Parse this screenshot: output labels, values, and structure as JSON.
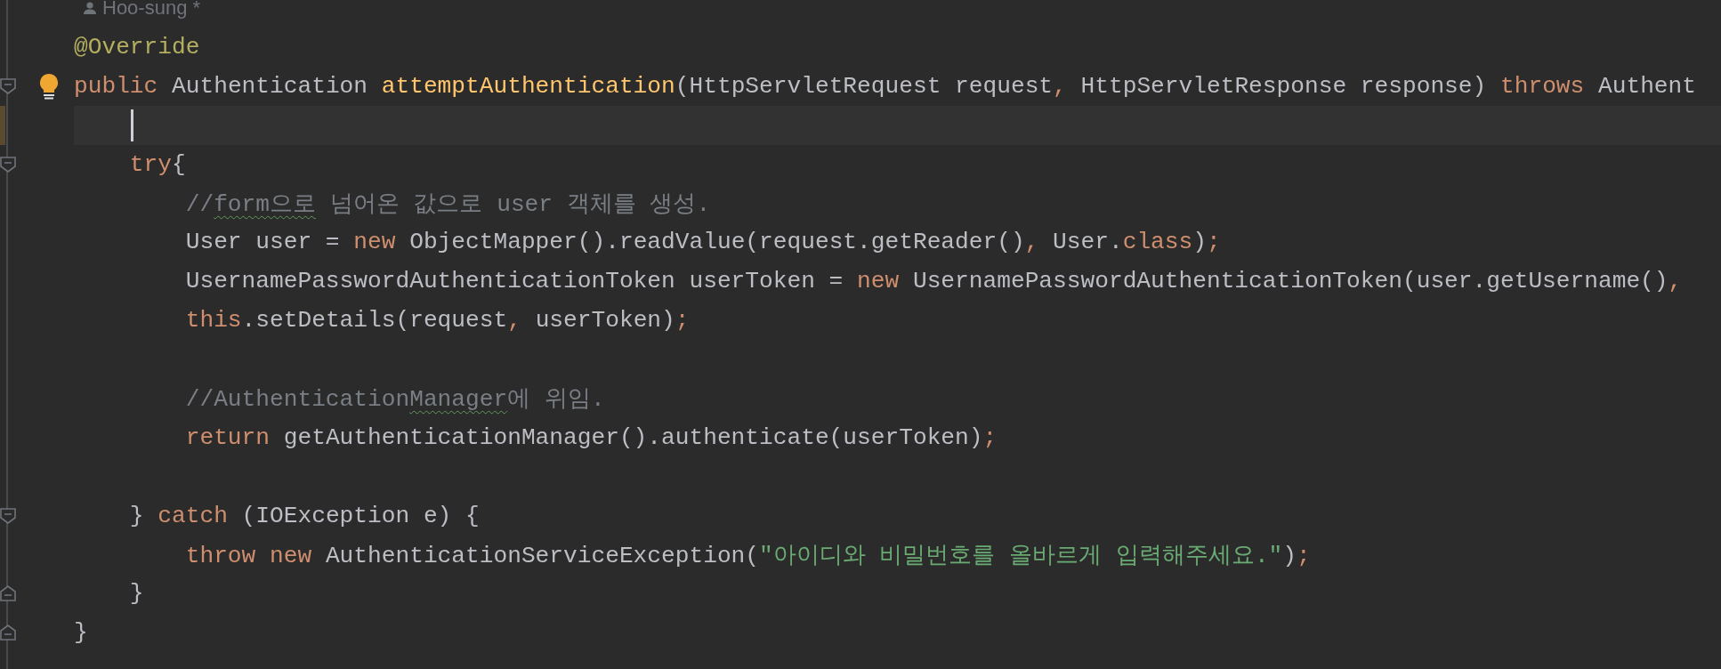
{
  "author": {
    "name": "Hoo-sung",
    "modified_mark": "*"
  },
  "lines": [
    {
      "current": false,
      "fold_start": false,
      "fold_end": false,
      "bulb": false,
      "tokens": [
        {
          "kind": "annotation",
          "text": "@Override"
        }
      ]
    },
    {
      "current": false,
      "fold_start": true,
      "fold_end": false,
      "bulb": true,
      "tokens": [
        {
          "kind": "keyword",
          "text": "public "
        },
        {
          "kind": "plain",
          "text": "Authentication "
        },
        {
          "kind": "function",
          "text": "attemptAuthentication"
        },
        {
          "kind": "plain",
          "text": "(HttpServletRequest request"
        },
        {
          "kind": "keyword",
          "text": ", "
        },
        {
          "kind": "plain",
          "text": "HttpServletResponse response) "
        },
        {
          "kind": "keyword",
          "text": "throws "
        },
        {
          "kind": "plain",
          "text": "Authent"
        }
      ]
    },
    {
      "current": true,
      "fold_start": false,
      "fold_end": false,
      "bulb": false
    },
    {
      "current": false,
      "fold_start": true,
      "fold_end": false,
      "bulb": false,
      "tokens": [
        {
          "kind": "keyword",
          "text": "    try"
        },
        {
          "kind": "plain",
          "text": "{"
        }
      ]
    },
    {
      "current": false,
      "fold_start": false,
      "fold_end": false,
      "bulb": false,
      "tokens": [
        {
          "kind": "comment",
          "text": "        //"
        },
        {
          "kind": "typo",
          "text": "form으로"
        },
        {
          "kind": "comment",
          "text": " 넘어온 값으로 user 객체를 생성."
        }
      ]
    },
    {
      "current": false,
      "fold_start": false,
      "fold_end": false,
      "bulb": false,
      "tokens": [
        {
          "kind": "plain",
          "text": "        User user = "
        },
        {
          "kind": "keyword",
          "text": "new "
        },
        {
          "kind": "plain",
          "text": "ObjectMapper().readValue(request.getReader()"
        },
        {
          "kind": "keyword",
          "text": ", "
        },
        {
          "kind": "plain",
          "text": "User."
        },
        {
          "kind": "keyword",
          "text": "class"
        },
        {
          "kind": "plain",
          "text": ")"
        },
        {
          "kind": "keyword",
          "text": ";"
        }
      ]
    },
    {
      "current": false,
      "fold_start": false,
      "fold_end": false,
      "bulb": false,
      "tokens": [
        {
          "kind": "plain",
          "text": "        UsernamePasswordAuthenticationToken userToken = "
        },
        {
          "kind": "keyword",
          "text": "new "
        },
        {
          "kind": "plain",
          "text": "UsernamePasswordAuthenticationToken(user.getUsername()"
        },
        {
          "kind": "keyword",
          "text": ","
        }
      ]
    },
    {
      "current": false,
      "fold_start": false,
      "fold_end": false,
      "bulb": false,
      "tokens": [
        {
          "kind": "keyword",
          "text": "        this"
        },
        {
          "kind": "plain",
          "text": ".setDetails(request"
        },
        {
          "kind": "keyword",
          "text": ", "
        },
        {
          "kind": "plain",
          "text": "userToken)"
        },
        {
          "kind": "keyword",
          "text": ";"
        }
      ]
    },
    {
      "current": false,
      "fold_start": false,
      "fold_end": false,
      "bulb": false
    },
    {
      "current": false,
      "fold_start": false,
      "fold_end": false,
      "bulb": false,
      "tokens": [
        {
          "kind": "comment",
          "text": "        //Authentication"
        },
        {
          "kind": "typo",
          "text": "Manager"
        },
        {
          "kind": "comment",
          "text": "에 위임."
        }
      ]
    },
    {
      "current": false,
      "fold_start": false,
      "fold_end": false,
      "bulb": false,
      "tokens": [
        {
          "kind": "keyword",
          "text": "        return "
        },
        {
          "kind": "plain",
          "text": "getAuthenticationManager().authenticate(userToken)"
        },
        {
          "kind": "keyword",
          "text": ";"
        }
      ]
    },
    {
      "current": false,
      "fold_start": false,
      "fold_end": false,
      "bulb": false
    },
    {
      "current": false,
      "fold_start": true,
      "fold_end": false,
      "bulb": false,
      "tokens": [
        {
          "kind": "plain",
          "text": "    } "
        },
        {
          "kind": "keyword",
          "text": "catch "
        },
        {
          "kind": "plain",
          "text": "(IOException e) {"
        }
      ]
    },
    {
      "current": false,
      "fold_start": false,
      "fold_end": false,
      "bulb": false,
      "tokens": [
        {
          "kind": "keyword",
          "text": "        throw new "
        },
        {
          "kind": "plain",
          "text": "AuthenticationServiceException("
        },
        {
          "kind": "string",
          "text": "\"아이디와 비밀번호를 올바르게 입력해주세요.\""
        },
        {
          "kind": "plain",
          "text": ")"
        },
        {
          "kind": "keyword",
          "text": ";"
        }
      ]
    },
    {
      "current": false,
      "fold_start": false,
      "fold_end": true,
      "bulb": false,
      "tokens": [
        {
          "kind": "plain",
          "text": "    }"
        }
      ]
    },
    {
      "current": false,
      "fold_start": false,
      "fold_end": true,
      "bulb": false,
      "tokens": [
        {
          "kind": "plain",
          "text": "}"
        }
      ]
    }
  ]
}
